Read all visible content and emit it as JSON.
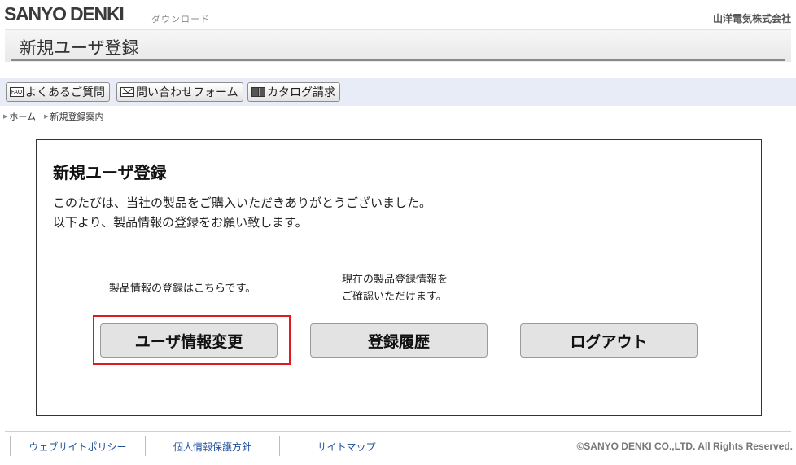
{
  "header": {
    "logo": "SANYO DENKI",
    "subtitle": "ダウンロード",
    "company": "山洋電気株式会社"
  },
  "title_bar": {
    "title": "新規ユーザ登録"
  },
  "toolbar": {
    "faq_icon": "FAQ",
    "faq_label": "よくあるご質問",
    "contact_label": "問い合わせフォーム",
    "catalog_label": "カタログ請求"
  },
  "breadcrumb": {
    "home": "ホーム",
    "current": "新規登録案内"
  },
  "main": {
    "title": "新規ユーザ登録",
    "line1": "このたびは、当社の製品をご購入いただきありがとうございました。",
    "line2": "以下より、製品情報の登録をお願い致します。",
    "hint1": "製品情報の登録はこちらです。",
    "hint2_line1": "現在の製品登録情報を",
    "hint2_line2": "ご確認いただけます。",
    "btn_change_user": "ユーザ情報変更",
    "btn_history": "登録履歴",
    "btn_logout": "ログアウト",
    "highlight_color": "#e0181f"
  },
  "footer": {
    "links": [
      "ウェブサイトポリシー",
      "個人情報保護方針",
      "サイトマップ"
    ],
    "copyright": "©SANYO DENKI CO.,LTD. All Rights Reserved."
  },
  "icons": [
    "faq-icon",
    "mail-icon",
    "book-icon",
    "arrow-right-icon"
  ]
}
